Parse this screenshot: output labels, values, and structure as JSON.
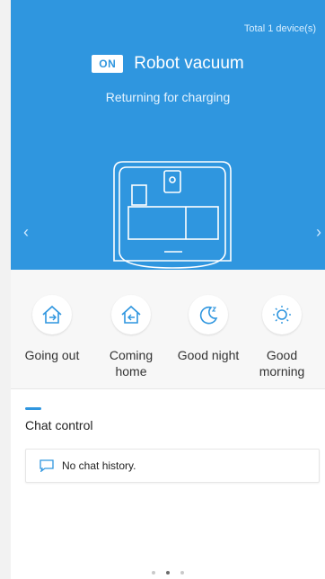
{
  "header": {
    "total_devices": "Total 1 device(s)",
    "power_badge": "ON",
    "device_name": "Robot vacuum",
    "status": "Returning for charging",
    "left_arrow": "‹",
    "right_arrow": "›"
  },
  "scenes": [
    {
      "label": "Going out",
      "icon": "going-out-icon"
    },
    {
      "label": "Coming home",
      "icon": "coming-home-icon"
    },
    {
      "label": "Good night",
      "icon": "good-night-icon"
    },
    {
      "label": "Good morning",
      "icon": "good-morning-icon"
    }
  ],
  "chat": {
    "heading": "Chat control",
    "empty_text": "No chat history."
  },
  "pager": {
    "count": 3,
    "active_index": 1
  },
  "colors": {
    "accent": "#2f96df"
  }
}
